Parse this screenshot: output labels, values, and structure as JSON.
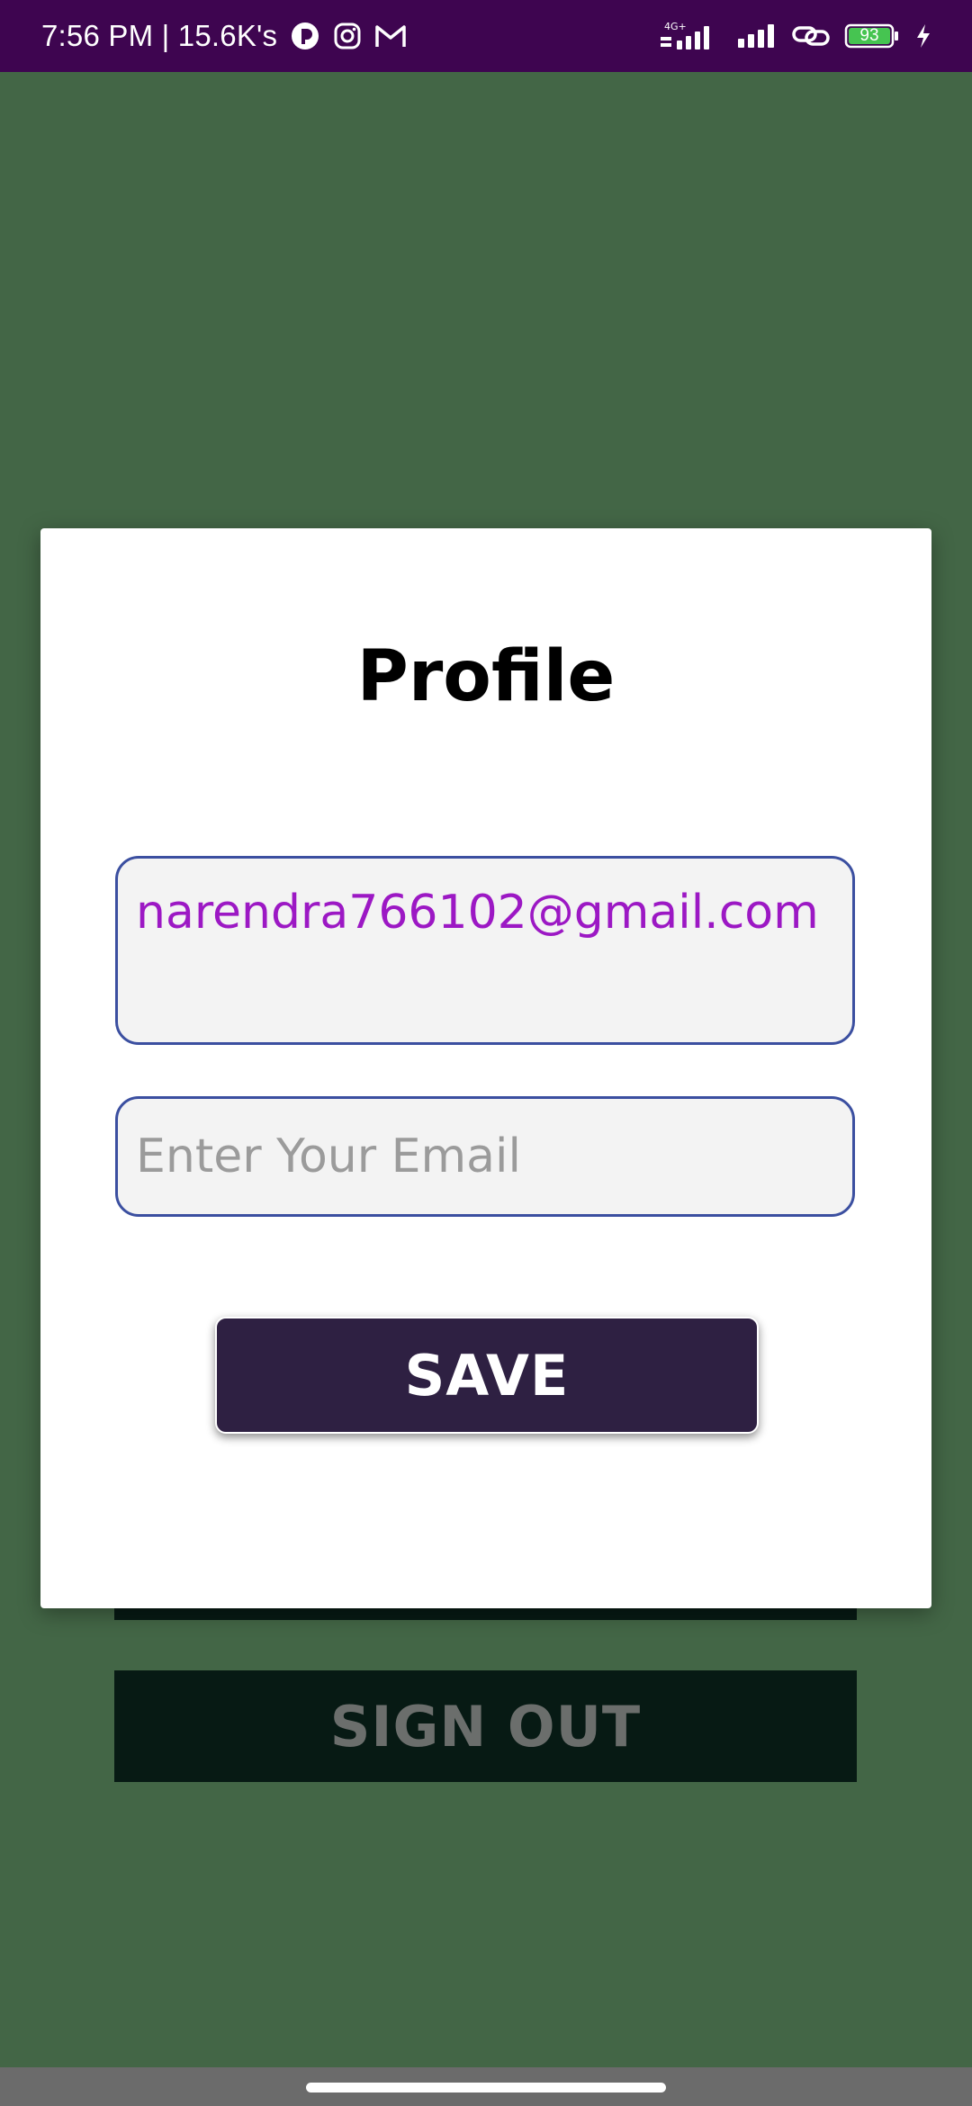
{
  "status_bar": {
    "time": "7:56 PM | 15.6K's",
    "network_label": "4G+",
    "battery_level": "93",
    "icons": [
      "data-saver-icon",
      "instagram-icon",
      "gmail-icon",
      "signal-4g-icon",
      "signal-icon",
      "link-icon",
      "battery-icon",
      "charging-icon"
    ],
    "background_color": "#3e0550"
  },
  "background": {
    "color": "#436646",
    "signout_label": "SIGN OUT"
  },
  "dialog": {
    "title": "Profile",
    "email_value": "narendra766102@gmail.com",
    "email_placeholder": "Enter Your Email",
    "save_label": "SAVE",
    "accent_color": "#2e2042",
    "value_color": "#9c18c4"
  }
}
